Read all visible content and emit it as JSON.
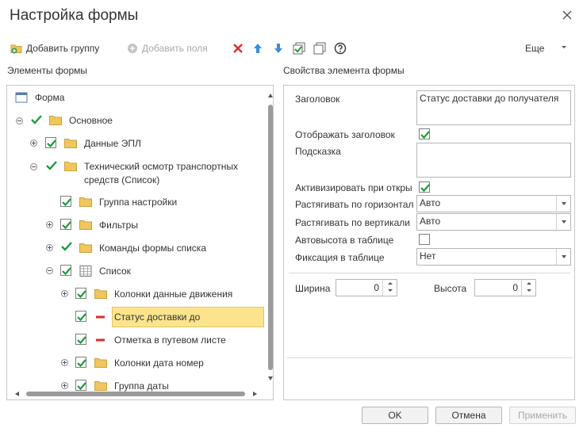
{
  "window": {
    "title": "Настройка формы"
  },
  "toolbar": {
    "add_group": "Добавить группу",
    "add_fields": "Добавить поля",
    "more": "Еще"
  },
  "left_section": {
    "label": "Элементы формы"
  },
  "right_section": {
    "label": "Свойства элемента формы"
  },
  "tree": [
    {
      "label": "Форма"
    },
    {
      "label": "Основное"
    },
    {
      "label": "Данные ЭПЛ"
    },
    {
      "label": "Технический осмотр транспортных"
    },
    {
      "label": "средств (Список)"
    },
    {
      "label": "Группа настройки"
    },
    {
      "label": "Фильтры"
    },
    {
      "label": "Команды формы списка"
    },
    {
      "label": "Список"
    },
    {
      "label": "Колонки данные движения"
    },
    {
      "label": "Статус доставки до"
    },
    {
      "label": "Отметка в путевом листе"
    },
    {
      "label": "Колонки дата номер"
    },
    {
      "label": "Группа даты"
    }
  ],
  "props": {
    "heading_label": "Заголовок",
    "heading_value": "Статус доставки до получателя",
    "show_heading_label": "Отображать заголовок",
    "show_heading_checked": true,
    "hint_label": "Подсказка",
    "hint_value": "",
    "activate_label": "Активизировать при откры",
    "activate_checked": true,
    "stretch_h_label": "Растягивать по горизонтал",
    "stretch_h_value": "Авто",
    "stretch_v_label": "Растягивать по вертикали",
    "stretch_v_value": "Авто",
    "autoheight_label": "Автовысота в таблице",
    "autoheight_checked": false,
    "fix_label": "Фиксация в таблице",
    "fix_value": "Нет",
    "width_label": "Ширина",
    "width_value": "0",
    "height_label": "Высота",
    "height_value": "0"
  },
  "buttons": {
    "ok": "OK",
    "cancel": "Отмена",
    "apply": "Применить"
  },
  "colors": {
    "check_green": "#1e9b3c",
    "folder": "#f0c75e",
    "selection": "#fbe48c",
    "delete_red": "#d9302c",
    "arrow_blue": "#3b8ed8"
  }
}
